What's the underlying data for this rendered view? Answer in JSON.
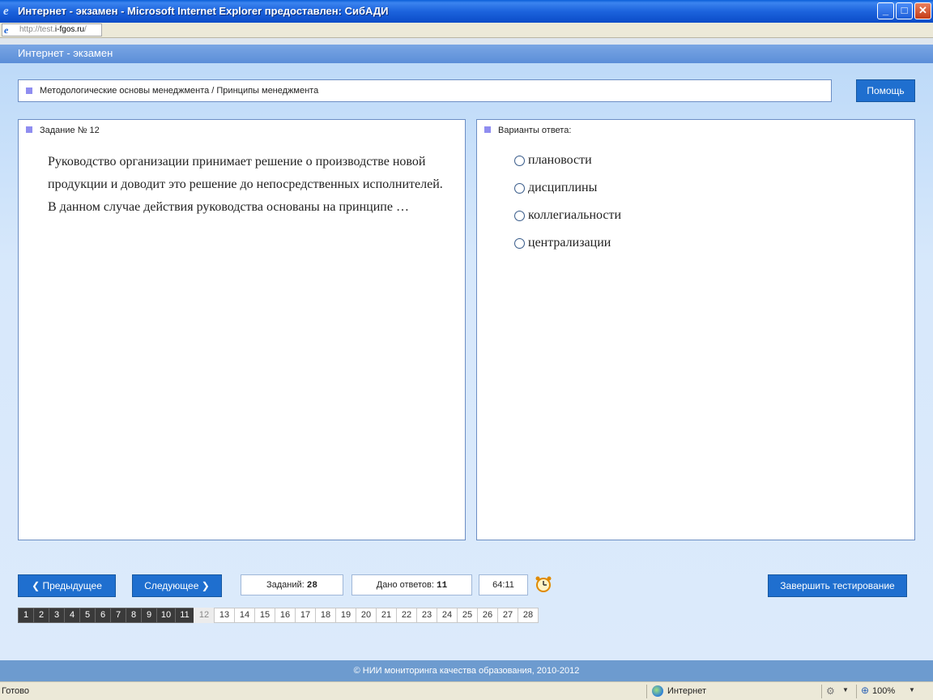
{
  "window": {
    "title": "Интернет - экзамен - Microsoft Internet Explorer предоставлен: СибАДИ",
    "minimize_glyph": "_",
    "maximize_glyph": "□",
    "close_glyph": "✕"
  },
  "address": {
    "prefix": "http://test.",
    "host": "i-fgos.ru",
    "suffix": "/"
  },
  "app": {
    "header_title": "Интернет - экзамен",
    "breadcrumb": "Методологические основы менеджмента / Принципы менеджмента",
    "help_label": "Помощь"
  },
  "task": {
    "title": "Задание № 12",
    "text": "Руководство организации принимает решение о производстве новой продукции и доводит это решение до непосредственных исполнителей. В данном случае действия руководства основаны на принципе …"
  },
  "answers": {
    "title": "Варианты ответа:",
    "options": [
      "плановости",
      "дисциплины",
      "коллегиальности",
      "централизации"
    ]
  },
  "controls": {
    "prev_label": "Предыдущее",
    "next_label": "Следующее",
    "total_label": "Заданий:",
    "total_value": "28",
    "answered_label": "Дано ответов:",
    "answered_value": "11",
    "timer": "64:11",
    "finish_label": "Завершить тестирование"
  },
  "question_nav": {
    "numbers": [
      "1",
      "2",
      "3",
      "4",
      "5",
      "6",
      "7",
      "8",
      "9",
      "10",
      "11",
      "12",
      "13",
      "14",
      "15",
      "16",
      "17",
      "18",
      "19",
      "20",
      "21",
      "22",
      "23",
      "24",
      "25",
      "26",
      "27",
      "28"
    ],
    "answered_count": 11,
    "current": "12"
  },
  "footer": {
    "text": "© НИИ мониторинга качества образования, 2010-2012"
  },
  "statusbar": {
    "status": "Готово",
    "zone": "Интернет",
    "zoom": "100%"
  },
  "colors": {
    "accent_button": "#1f6fcf",
    "answered_cell": "#3a3a3a",
    "header_bar": "#5b8ed8",
    "footer_bar": "#6d9bcf"
  }
}
